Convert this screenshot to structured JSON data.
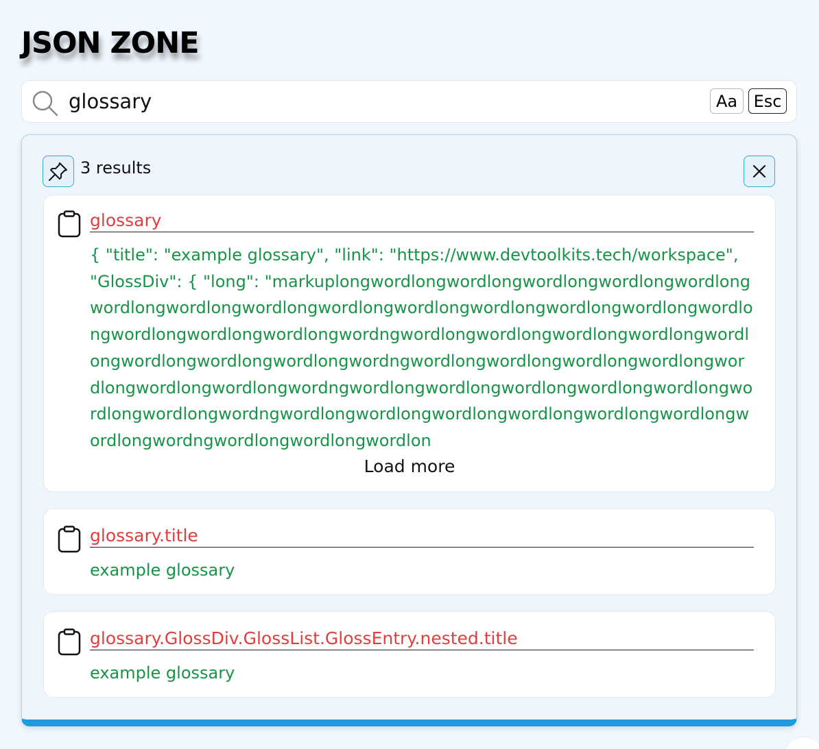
{
  "app": {
    "title": "JSON ZONE"
  },
  "search": {
    "value": "glossary",
    "case_label": "Aa",
    "esc_label": "Esc"
  },
  "results": {
    "count_label": "3 results",
    "items": [
      {
        "path": "glossary",
        "value": "{ \"title\": \"example glossary\", \"link\": \"https://www.devtoolkits.tech/workspace\", \"GlossDiv\": { \"long\": \"markuplongwordlongwordlongwordlongwordlongwordlongwordlongwordlongwordlongwordlongwordlongwordlongwordlongwordlongwordlongwordlongwordlongwordlongwordngwordlongwordlongwordlongwordlongwordlongwordlongwordlongwordlongwordngwordlongwordlongwordlongwordlongwordlongwordlongwordlongwordngwordlongwordlongwordlongwordlongwordlongwordlongwordlongwordngwordlongwordlongwordlongwordlongwordlongwordlongwordlongwordngwordlongwordlongwordlon",
        "load_more": "Load more"
      },
      {
        "path": "glossary.title",
        "value": "example glossary"
      },
      {
        "path": "glossary.GlossDiv.GlossList.GlossEntry.nested.title",
        "value": "example glossary"
      }
    ]
  },
  "colors": {
    "path": "#e03e3e",
    "value": "#179447",
    "accent": "#1b9cdc",
    "panel_border": "#a9d4ef"
  },
  "icons": {
    "search": "search-icon",
    "pin": "pin-icon",
    "close": "close-icon",
    "clipboard": "clipboard-icon"
  }
}
